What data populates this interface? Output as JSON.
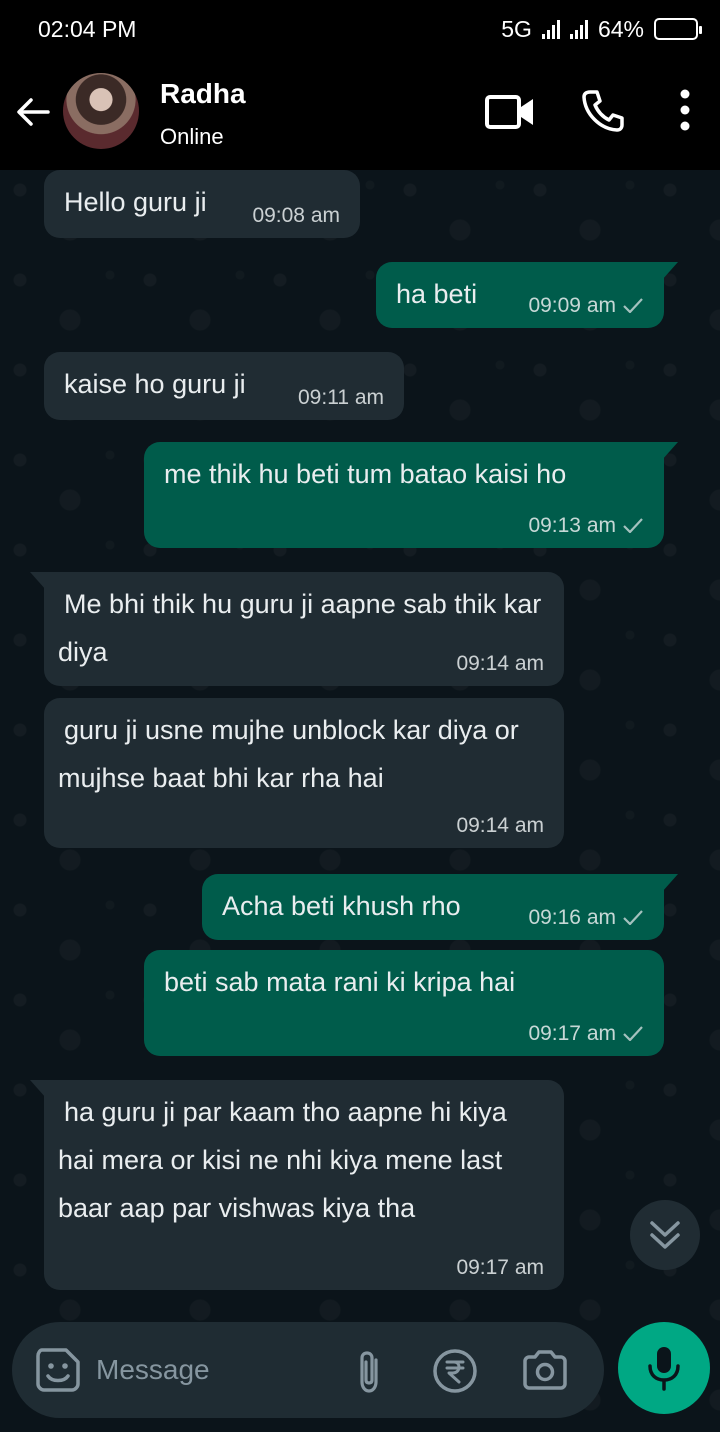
{
  "status_bar": {
    "time": "02:04 PM",
    "network": "5G",
    "battery": "64%",
    "battery_level": 0.64
  },
  "header": {
    "contact_name": "Radha",
    "contact_status": "Online",
    "icons": [
      "back-arrow-icon",
      "video-call-icon",
      "phone-call-icon",
      "more-options-icon"
    ]
  },
  "messages": [
    {
      "direction": "incoming",
      "text": "Hello guru ji",
      "time": "09:08 am"
    },
    {
      "direction": "outgoing",
      "text": "ha beti",
      "time": "09:09 am",
      "status": "sent"
    },
    {
      "direction": "incoming",
      "text": "kaise ho guru ji",
      "time": "09:11 am"
    },
    {
      "direction": "outgoing",
      "text": "me thik hu beti tum batao kaisi ho",
      "time": "09:13 am",
      "status": "sent"
    },
    {
      "direction": "incoming",
      "text": "Me bhi thik hu guru ji aapne sab thik kar diya",
      "time": "09:14 am"
    },
    {
      "direction": "incoming",
      "text": "guru ji usne mujhe unblock kar diya or mujhse baat bhi kar rha hai",
      "time": "09:14 am"
    },
    {
      "direction": "outgoing",
      "text": "Acha beti khush rho",
      "time": "09:16 am",
      "status": "sent"
    },
    {
      "direction": "outgoing",
      "text": "beti sab mata rani ki kripa hai",
      "time": "09:17 am",
      "status": "sent"
    },
    {
      "direction": "incoming",
      "text": "ha guru ji par kaam tho aapne hi kiya hai mera or kisi ne nhi kiya mene last baar aap par vishwas kiya tha",
      "time": "09:17 am"
    }
  ],
  "composer": {
    "placeholder": "Message"
  },
  "colors": {
    "chat_background": "#0b141a",
    "incoming_bubble": "#202c33",
    "outgoing_bubble": "#005c4b",
    "mic_button": "#00a884"
  }
}
